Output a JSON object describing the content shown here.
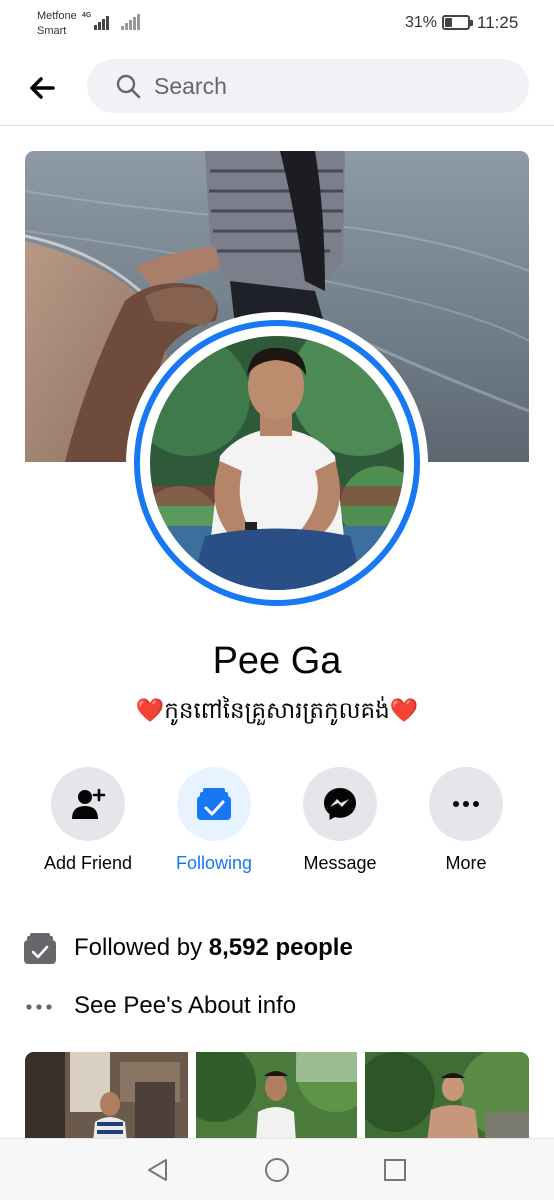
{
  "status_bar": {
    "carrier_line1": "Metfone",
    "carrier_line2": "Smart",
    "network": "4G",
    "battery_percent": "31%",
    "battery_level": 0.31,
    "time": "11:25"
  },
  "header": {
    "search_placeholder": "Search"
  },
  "profile": {
    "name": "Pee Ga",
    "bio": "កូនពៅនៃគ្រួសារត្រកូលគង់",
    "bio_emoji": "❤️"
  },
  "actions": [
    {
      "label": "Add Friend",
      "icon": "add-friend-icon"
    },
    {
      "label": "Following",
      "icon": "following-icon",
      "active": true
    },
    {
      "label": "Message",
      "icon": "messenger-icon"
    },
    {
      "label": "More",
      "icon": "more-icon"
    }
  ],
  "info": {
    "followed_prefix": "Followed by ",
    "followed_count": "8,592 people",
    "about_text": "See Pee's About info"
  },
  "colors": {
    "accent": "#1877f2",
    "button_bg": "#e4e6eb",
    "active_bg": "#e7f3ff",
    "heart": "#e0182d"
  }
}
